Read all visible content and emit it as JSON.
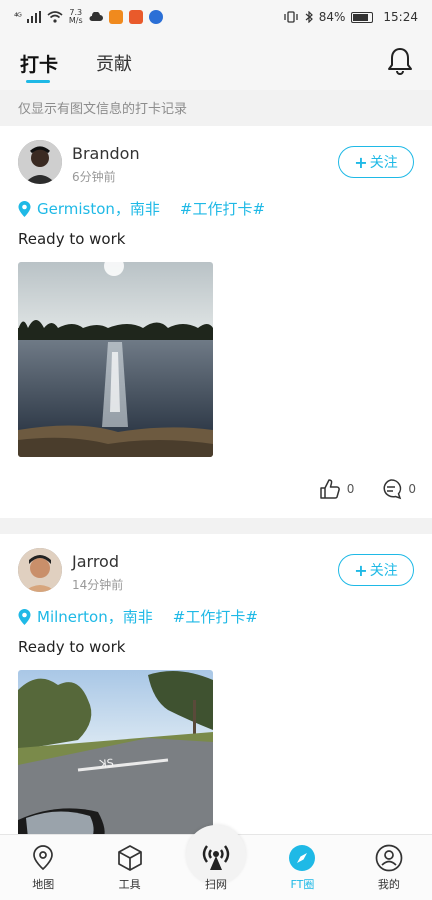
{
  "status_bar": {
    "signal": "⁴ᴳ",
    "speed_value": "7.3",
    "speed_unit": "M/s",
    "battery_percent": "84%",
    "time": "15:24"
  },
  "header": {
    "tabs": [
      {
        "label": "打卡",
        "active": true
      },
      {
        "label": "贡献",
        "active": false
      }
    ]
  },
  "notice": "仅显示有图文信息的打卡记录",
  "posts": [
    {
      "username": "Brandon",
      "time_ago": "6分钟前",
      "follow_label": "关注",
      "location": "Germiston，南非",
      "tag": "#工作打卡#",
      "text": "Ready to work",
      "likes": "0",
      "comments": "0"
    },
    {
      "username": "Jarrod",
      "time_ago": "14分钟前",
      "follow_label": "关注",
      "location": "Milnerton，南非",
      "tag": "#工作打卡#",
      "text": "Ready to work"
    }
  ],
  "bottom_nav": [
    {
      "label": "地图",
      "icon": "map-pin-icon"
    },
    {
      "label": "工具",
      "icon": "cube-icon"
    },
    {
      "label": "扫网",
      "icon": "antenna-icon"
    },
    {
      "label": "FT圈",
      "icon": "compass-icon",
      "active": true
    },
    {
      "label": "我的",
      "icon": "user-icon"
    }
  ],
  "colors": {
    "accent": "#1fb9e6",
    "text": "#222222",
    "muted": "#999999"
  }
}
